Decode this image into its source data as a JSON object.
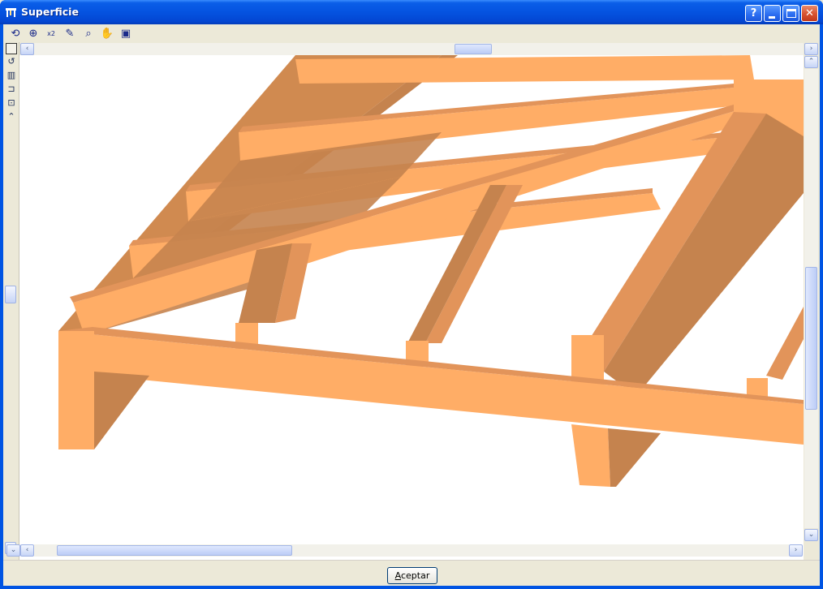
{
  "window": {
    "title": "Superficie",
    "buttons": {
      "help": "?",
      "minimize": "_",
      "maximize": "□",
      "close": "✕"
    }
  },
  "toolbar": {
    "tools": [
      {
        "name": "select-3d-icon",
        "glyph": "⟲"
      },
      {
        "name": "zoom-window-icon",
        "glyph": "⊕"
      },
      {
        "name": "zoom-x2-icon",
        "glyph": "x2"
      },
      {
        "name": "edit-pen-icon",
        "glyph": "✎"
      },
      {
        "name": "zoom-realtime-icon",
        "glyph": "⌕"
      },
      {
        "name": "pan-hand-icon",
        "glyph": "✋"
      },
      {
        "name": "view-options-icon",
        "glyph": "▣"
      }
    ]
  },
  "sidetools": {
    "items": [
      {
        "name": "solid-view-icon",
        "glyph": ""
      },
      {
        "name": "rotate-icon",
        "glyph": "↺"
      },
      {
        "name": "bars-icon",
        "glyph": "▥"
      },
      {
        "name": "profile-icon",
        "glyph": "⊐"
      },
      {
        "name": "display-icon",
        "glyph": "⊡"
      },
      {
        "name": "scroll-up-icon",
        "glyph": "⌃"
      }
    ]
  },
  "dialog": {
    "accept_prefix": "A",
    "accept_rest": "ceptar"
  },
  "colors": {
    "beam_light": "#ffad66",
    "beam_mid": "#e2945a",
    "beam_dark": "#c5834e",
    "title_blue": "#0054e3"
  }
}
